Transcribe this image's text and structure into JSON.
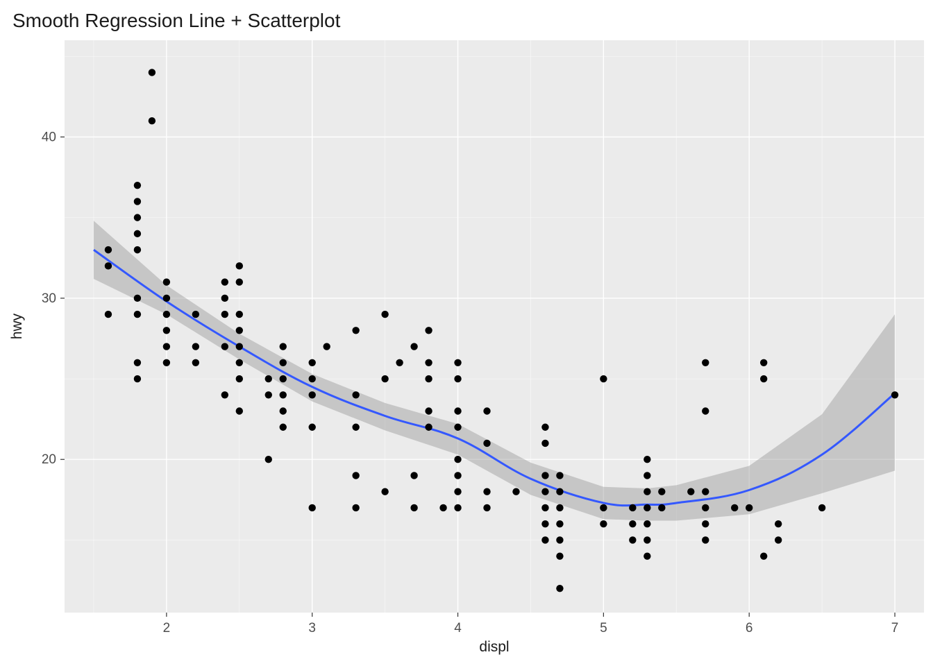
{
  "chart_data": {
    "type": "scatter",
    "title": "Smooth Regression Line + Scatterplot",
    "xlabel": "displ",
    "ylabel": "hwy",
    "xlim": [
      1.3,
      7.2
    ],
    "ylim": [
      10.5,
      46
    ],
    "x_ticks": [
      2,
      3,
      4,
      5,
      6,
      7
    ],
    "y_ticks": [
      20,
      30,
      40
    ],
    "points": [
      [
        1.6,
        29
      ],
      [
        1.6,
        32
      ],
      [
        1.6,
        33
      ],
      [
        1.8,
        25
      ],
      [
        1.8,
        26
      ],
      [
        1.8,
        29
      ],
      [
        1.8,
        30
      ],
      [
        1.8,
        33
      ],
      [
        1.8,
        34
      ],
      [
        1.8,
        35
      ],
      [
        1.8,
        36
      ],
      [
        1.8,
        37
      ],
      [
        1.9,
        41
      ],
      [
        1.9,
        44
      ],
      [
        2.0,
        26
      ],
      [
        2.0,
        27
      ],
      [
        2.0,
        28
      ],
      [
        2.0,
        29
      ],
      [
        2.0,
        30
      ],
      [
        2.0,
        31
      ],
      [
        2.2,
        26
      ],
      [
        2.2,
        27
      ],
      [
        2.2,
        29
      ],
      [
        2.4,
        24
      ],
      [
        2.4,
        27
      ],
      [
        2.4,
        29
      ],
      [
        2.4,
        30
      ],
      [
        2.4,
        31
      ],
      [
        2.5,
        23
      ],
      [
        2.5,
        25
      ],
      [
        2.5,
        26
      ],
      [
        2.5,
        27
      ],
      [
        2.5,
        28
      ],
      [
        2.5,
        29
      ],
      [
        2.5,
        31
      ],
      [
        2.5,
        32
      ],
      [
        2.7,
        20
      ],
      [
        2.7,
        24
      ],
      [
        2.7,
        25
      ],
      [
        2.8,
        22
      ],
      [
        2.8,
        23
      ],
      [
        2.8,
        24
      ],
      [
        2.8,
        25
      ],
      [
        2.8,
        26
      ],
      [
        2.8,
        27
      ],
      [
        3.0,
        17
      ],
      [
        3.0,
        22
      ],
      [
        3.0,
        24
      ],
      [
        3.0,
        25
      ],
      [
        3.0,
        26
      ],
      [
        3.1,
        27
      ],
      [
        3.3,
        17
      ],
      [
        3.3,
        19
      ],
      [
        3.3,
        22
      ],
      [
        3.3,
        24
      ],
      [
        3.3,
        28
      ],
      [
        3.5,
        18
      ],
      [
        3.5,
        25
      ],
      [
        3.5,
        29
      ],
      [
        3.6,
        26
      ],
      [
        3.7,
        17
      ],
      [
        3.7,
        19
      ],
      [
        3.7,
        27
      ],
      [
        3.8,
        22
      ],
      [
        3.8,
        23
      ],
      [
        3.8,
        25
      ],
      [
        3.8,
        26
      ],
      [
        3.8,
        28
      ],
      [
        3.9,
        17
      ],
      [
        4.0,
        17
      ],
      [
        4.0,
        18
      ],
      [
        4.0,
        19
      ],
      [
        4.0,
        20
      ],
      [
        4.0,
        22
      ],
      [
        4.0,
        23
      ],
      [
        4.0,
        25
      ],
      [
        4.0,
        26
      ],
      [
        4.2,
        17
      ],
      [
        4.2,
        18
      ],
      [
        4.2,
        21
      ],
      [
        4.2,
        23
      ],
      [
        4.4,
        18
      ],
      [
        4.6,
        15
      ],
      [
        4.6,
        16
      ],
      [
        4.6,
        17
      ],
      [
        4.6,
        18
      ],
      [
        4.6,
        19
      ],
      [
        4.6,
        21
      ],
      [
        4.6,
        22
      ],
      [
        4.7,
        12
      ],
      [
        4.7,
        14
      ],
      [
        4.7,
        15
      ],
      [
        4.7,
        16
      ],
      [
        4.7,
        17
      ],
      [
        4.7,
        18
      ],
      [
        4.7,
        19
      ],
      [
        5.0,
        16
      ],
      [
        5.0,
        17
      ],
      [
        5.0,
        25
      ],
      [
        5.2,
        15
      ],
      [
        5.2,
        16
      ],
      [
        5.2,
        17
      ],
      [
        5.3,
        14
      ],
      [
        5.3,
        15
      ],
      [
        5.3,
        16
      ],
      [
        5.3,
        17
      ],
      [
        5.3,
        18
      ],
      [
        5.3,
        19
      ],
      [
        5.3,
        20
      ],
      [
        5.4,
        17
      ],
      [
        5.4,
        18
      ],
      [
        5.6,
        18
      ],
      [
        5.7,
        15
      ],
      [
        5.7,
        16
      ],
      [
        5.7,
        17
      ],
      [
        5.7,
        18
      ],
      [
        5.7,
        23
      ],
      [
        5.7,
        26
      ],
      [
        5.9,
        17
      ],
      [
        6.0,
        17
      ],
      [
        6.1,
        14
      ],
      [
        6.1,
        25
      ],
      [
        6.1,
        26
      ],
      [
        6.2,
        15
      ],
      [
        6.2,
        16
      ],
      [
        6.5,
        17
      ],
      [
        7.0,
        24
      ]
    ],
    "smooth": {
      "x": [
        1.5,
        2.0,
        2.5,
        3.0,
        3.5,
        4.0,
        4.5,
        5.0,
        5.3,
        5.5,
        6.0,
        6.5,
        7.0
      ],
      "y": [
        33.0,
        29.8,
        27.0,
        24.5,
        22.7,
        21.3,
        18.8,
        17.3,
        17.2,
        17.3,
        18.1,
        20.3,
        24.1
      ],
      "lower": [
        31.2,
        29.0,
        26.2,
        23.6,
        21.8,
        20.3,
        17.8,
        16.3,
        16.2,
        16.2,
        16.6,
        17.9,
        19.3
      ],
      "upper": [
        34.8,
        30.8,
        27.8,
        25.3,
        23.5,
        22.2,
        19.8,
        18.3,
        18.2,
        18.4,
        19.6,
        22.8,
        29.0
      ]
    },
    "colors": {
      "panel_bg": "#ebebeb",
      "grid": "#ffffff",
      "line": "#3458ff",
      "ribbon": "#999999"
    }
  }
}
